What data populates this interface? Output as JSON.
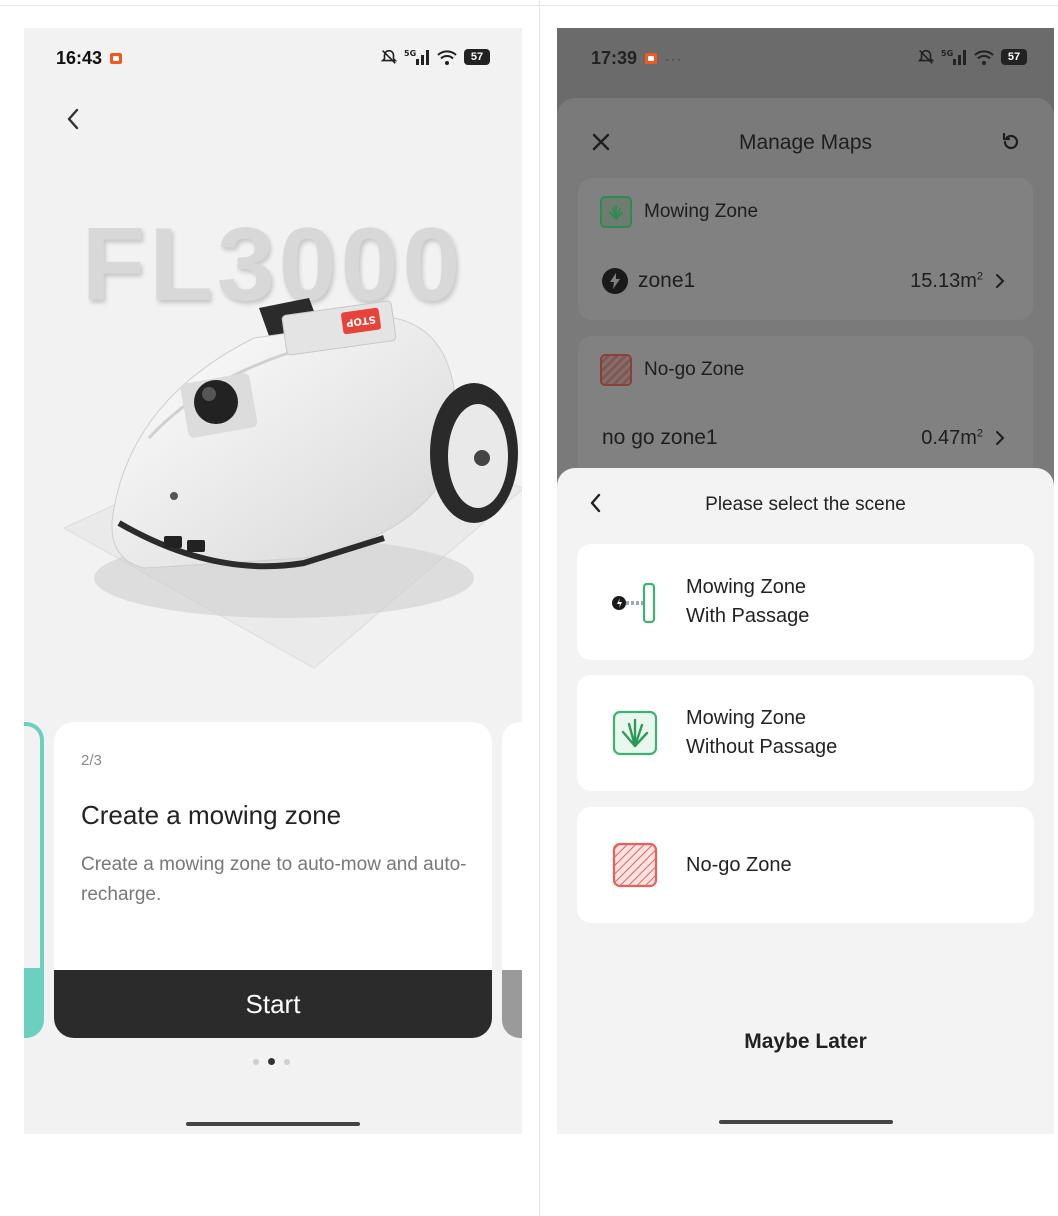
{
  "left_screen": {
    "status_bar": {
      "time": "16:43",
      "battery": "57"
    },
    "hero_title": "FL3000",
    "mower_label": "STOP",
    "card": {
      "step": "2/3",
      "title": "Create a mowing zone",
      "description": "Create a mowing zone to auto-mow and auto-recharge.",
      "start_label": "Start"
    },
    "pager": {
      "total": 3,
      "active": 2
    }
  },
  "right_screen": {
    "status_bar": {
      "time": "17:39",
      "more": "···",
      "battery": "57"
    },
    "manage_maps": {
      "title": "Manage Maps",
      "mowing_zone_header": "Mowing Zone",
      "mowing_zones": [
        {
          "name": "zone1",
          "area": "15.13m",
          "unit_sup": "2"
        }
      ],
      "nogo_zone_header": "No-go Zone",
      "nogo_zones": [
        {
          "name": "no go zone1",
          "area": "0.47m",
          "unit_sup": "2"
        }
      ]
    },
    "scene_sheet": {
      "title": "Please select the scene",
      "options": [
        {
          "line1": "Mowing Zone",
          "line2": "With Passage"
        },
        {
          "line1": "Mowing Zone",
          "line2": "Without Passage"
        },
        {
          "line1": "No-go Zone",
          "line2": ""
        }
      ],
      "maybe_later": "Maybe Later"
    }
  },
  "colors": {
    "accent_teal": "#6cd0be",
    "green": "#3cb371",
    "red": "#e8605a",
    "dark_button": "#2b2b2b"
  }
}
